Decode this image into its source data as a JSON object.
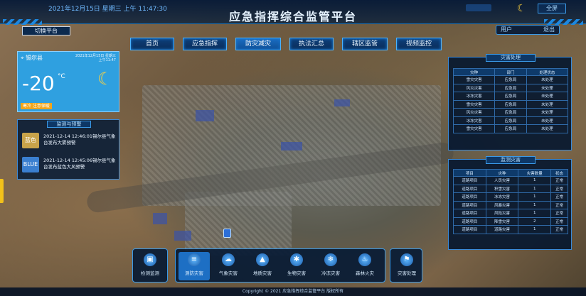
{
  "topbar": {
    "datetime": "2021年12月15日 星期三 上午 11:47:30",
    "title": "应急指挥综合监管平台",
    "home_label": "全屏"
  },
  "header": {
    "switch_label": "切换平台",
    "user_name": "用户",
    "logout_label": "退出"
  },
  "nav": {
    "items": [
      "首页",
      "应急指挥",
      "防灾减灾",
      "执法汇总",
      "辖区监管",
      "视频监控"
    ],
    "active": "防灾减灾"
  },
  "weather": {
    "city": "锡尔县",
    "date": "2021年12月15日 星期三 上午11:47",
    "temp": "-20",
    "unit": "°C",
    "alert": "寒冷 注意保暖"
  },
  "alerts": {
    "title": "监测与预警",
    "items": [
      {
        "badge": "蓝色",
        "text": "2021-12-14 12:46:01锡尔县气象台发布大雾预警"
      },
      {
        "badge": "BLUE",
        "text": "2021-12-14 12:45:06锡尔县气象台发布蓝色大风预警"
      }
    ]
  },
  "disaster_handling": {
    "title": "灾害处理",
    "headers": [
      "灾种",
      "部门",
      "处理状态"
    ],
    "rows": [
      [
        "雪灾灾害",
        "应急局",
        "未处理"
      ],
      [
        "风灾灾害",
        "应急局",
        "未处理"
      ],
      [
        "冰冻灾害",
        "应急局",
        "未处理"
      ],
      [
        "雪灾灾害",
        "应急局",
        "未处理"
      ],
      [
        "风灾灾害",
        "应急局",
        "未处理"
      ],
      [
        "冰冻灾害",
        "应急局",
        "未处理"
      ],
      [
        "雪灾灾害",
        "应急局",
        "未处理"
      ]
    ]
  },
  "monitoring": {
    "title": "监测灾害",
    "headers": [
      "项目",
      "灾种",
      "灾害数量",
      "状态"
    ],
    "rows": [
      [
        "道路项目",
        "人员灾害",
        "1",
        "正常"
      ],
      [
        "道路项目",
        "积雪灾害",
        "1",
        "正常"
      ],
      [
        "道路项目",
        "冰冻灾害",
        "1",
        "正常"
      ],
      [
        "道路项目",
        "风暴灾害",
        "1",
        "正常"
      ],
      [
        "道路项目",
        "风险灾害",
        "1",
        "正常"
      ],
      [
        "道路项目",
        "降雪灾害",
        "2",
        "正常"
      ],
      [
        "道路项目",
        "道路灾害",
        "1",
        "正常"
      ]
    ]
  },
  "bottom": {
    "left": {
      "label": "检测监测"
    },
    "items": [
      "测防灾害",
      "气象灾害",
      "地质灾害",
      "生物灾害",
      "冷冻灾害",
      "森林火灾"
    ],
    "selected": "测防灾害",
    "right": {
      "label": "灾害处理"
    }
  },
  "footer": "Copyright © 2021 应急指挥综合监管平台 版权所有",
  "colors": {
    "accent": "#2a8ad8",
    "weather_bg": "#2fa0e0",
    "alert": "#f2a51a",
    "moon": "#ffd23c"
  }
}
